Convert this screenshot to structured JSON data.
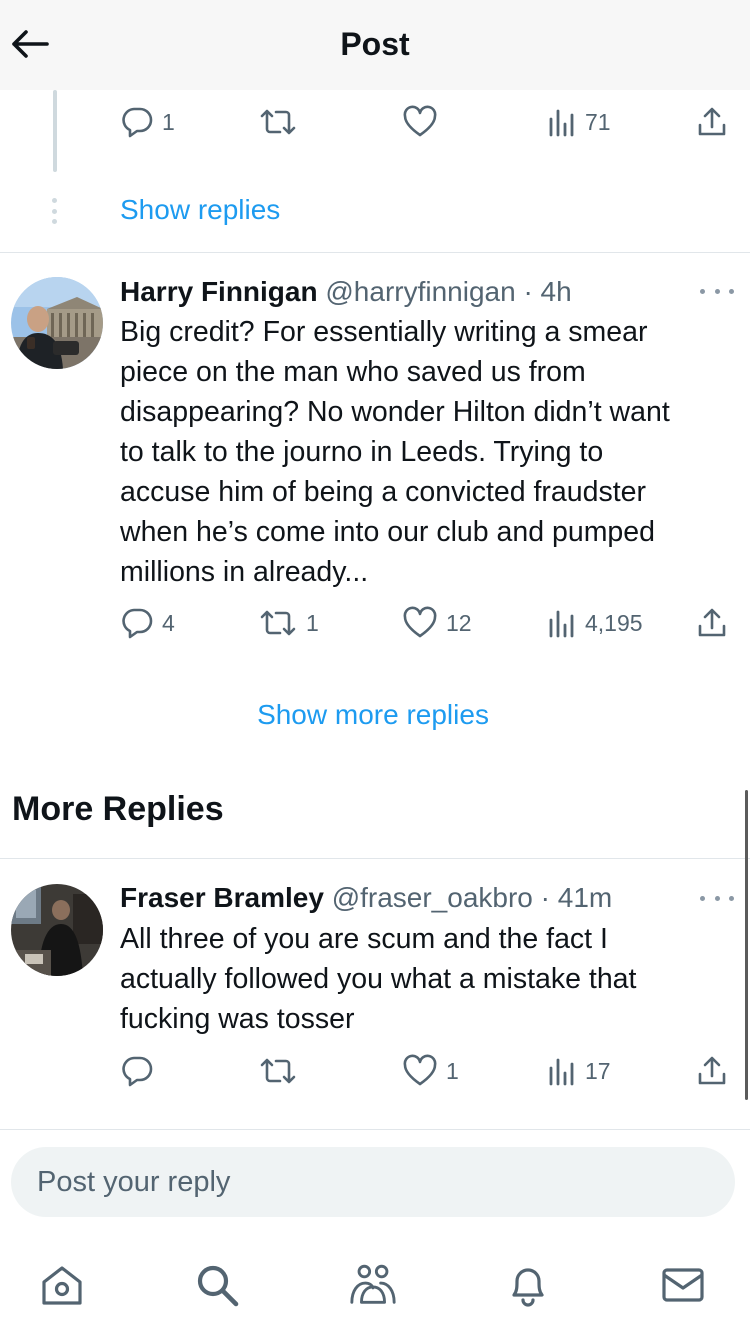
{
  "header": {
    "title": "Post"
  },
  "top_tweet": {
    "actions": {
      "replies": "1",
      "reposts": "",
      "likes": "",
      "views": "71"
    },
    "show_replies_label": "Show replies"
  },
  "tweet1": {
    "display_name": "Harry Finnigan",
    "handle_time": "@harryfinnigan · 4h",
    "lines": [
      "Big credit? For essentially writing a smear",
      "piece on the man who saved us from",
      "disappearing? No wonder Hilton didn’t want",
      "to talk to the journo in Leeds. Trying to",
      "accuse him of being a convicted fraudster",
      "when he’s come into our club and pumped",
      "millions in already..."
    ],
    "actions": {
      "replies": "4",
      "reposts": "1",
      "likes": "12",
      "views": "4,195"
    }
  },
  "show_more_replies_label": "Show more replies",
  "more_replies_title": "More Replies",
  "tweet2": {
    "display_name": "Fraser Bramley",
    "handle_time": "@fraser_oakbro · 41m",
    "lines": [
      "All three of you are scum and the fact I",
      "actually followed you what a mistake that",
      "fucking was tosser"
    ],
    "actions": {
      "replies": "",
      "reposts": "",
      "likes": "1",
      "views": "17"
    }
  },
  "reply_box": {
    "placeholder": "Post your reply"
  },
  "tabbar": {
    "icons": [
      "home-icon",
      "search-icon",
      "communities-icon",
      "notifications-icon",
      "messages-icon"
    ]
  },
  "colors": {
    "link": "#1d9bf0",
    "muted": "#536471",
    "text": "#0f1419",
    "divider": "#e1e6ea",
    "header_bg": "#f7f7f7"
  }
}
